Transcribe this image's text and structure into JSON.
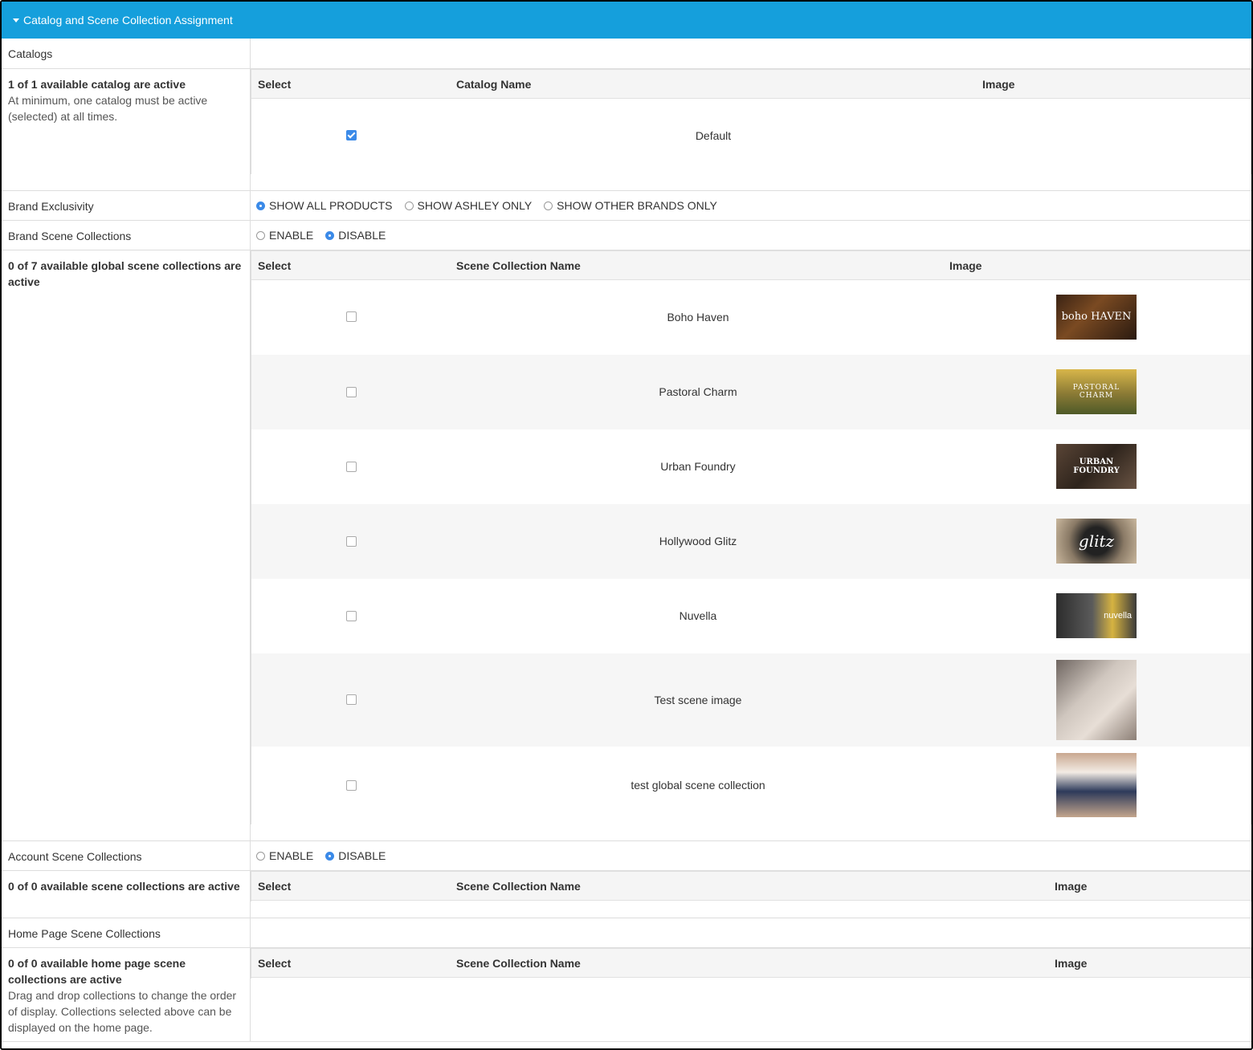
{
  "header": {
    "title": "Catalog and Scene Collection Assignment"
  },
  "catalogs": {
    "label": "Catalogs",
    "summary": "1 of 1 available catalog are active",
    "note": "At minimum, one catalog must be active (selected) at all times.",
    "columns": {
      "select": "Select",
      "name": "Catalog Name",
      "image": "Image"
    },
    "rows": [
      {
        "name": "Default",
        "selected": true
      }
    ]
  },
  "brand_exclusivity": {
    "label": "Brand Exclusivity",
    "options": [
      "SHOW ALL PRODUCTS",
      "SHOW ASHLEY ONLY",
      "SHOW OTHER BRANDS ONLY"
    ],
    "selected": "SHOW ALL PRODUCTS"
  },
  "brand_scene_collections": {
    "label": "Brand Scene Collections",
    "options": [
      "ENABLE",
      "DISABLE"
    ],
    "selected": "DISABLE"
  },
  "global_scene_collections": {
    "summary": "0 of 7 available global scene collections are active",
    "columns": {
      "select": "Select",
      "name": "Scene Collection Name",
      "image": "Image"
    },
    "rows": [
      {
        "name": "Boho Haven",
        "selected": false,
        "thumb_text": "boho HAVEN",
        "thumb_icon": "boho-haven-thumbnail"
      },
      {
        "name": "Pastoral Charm",
        "selected": false,
        "thumb_text": "PASTORAL CHARM",
        "thumb_icon": "pastoral-charm-thumbnail"
      },
      {
        "name": "Urban Foundry",
        "selected": false,
        "thumb_text": "URBAN FOUNDRY",
        "thumb_icon": "urban-foundry-thumbnail"
      },
      {
        "name": "Hollywood Glitz",
        "selected": false,
        "thumb_text": "glitz",
        "thumb_icon": "hollywood-glitz-thumbnail"
      },
      {
        "name": "Nuvella",
        "selected": false,
        "thumb_text": "nuvella",
        "thumb_icon": "nuvella-thumbnail"
      },
      {
        "name": "Test scene image",
        "selected": false,
        "thumb_text": "",
        "thumb_icon": "bedroom-pillows-thumbnail"
      },
      {
        "name": "test global scene collection",
        "selected": false,
        "thumb_text": "",
        "thumb_icon": "kids-bedroom-thumbnail"
      }
    ]
  },
  "account_scene_collections": {
    "label": "Account Scene Collections",
    "options": [
      "ENABLE",
      "DISABLE"
    ],
    "selected": "DISABLE",
    "summary": "0 of 0 available scene collections are active",
    "columns": {
      "select": "Select",
      "name": "Scene Collection Name",
      "image": "Image"
    }
  },
  "home_page_scene_collections": {
    "label": "Home Page Scene Collections",
    "summary": "0 of 0 available home page scene collections are active",
    "note": "Drag and drop collections to change the order of display. Collections selected above can be displayed on the home page.",
    "columns": {
      "select": "Select",
      "name": "Scene Collection Name",
      "image": "Image"
    }
  },
  "colors": {
    "header": "#159fdc",
    "accent": "#3b8ae8",
    "alt_row": "#f6f6f6"
  }
}
